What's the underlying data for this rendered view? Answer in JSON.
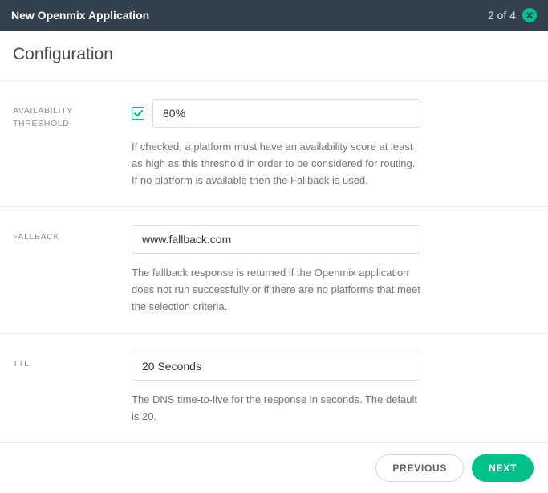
{
  "header": {
    "title": "New Openmix Application",
    "step": "2 of 4"
  },
  "section_title": "Configuration",
  "fields": {
    "availability": {
      "label": "AVAILABILITY THRESHOLD",
      "value": "80%",
      "checked": true,
      "help": "If checked, a platform must have an availability score at least as high as this threshold in order to be considered for routing. If no platform is available then the Fallback is used."
    },
    "fallback": {
      "label": "FALLBACK",
      "value": "www.fallback.com",
      "help": "The fallback response is returned if the Openmix application does not run successfully or if there are no platforms that meet the selection criteria."
    },
    "ttl": {
      "label": "TTL",
      "value": "20 Seconds",
      "help": "The DNS time-to-live for the response in seconds. The default is 20."
    }
  },
  "footer": {
    "previous": "PREVIOUS",
    "next": "NEXT"
  }
}
